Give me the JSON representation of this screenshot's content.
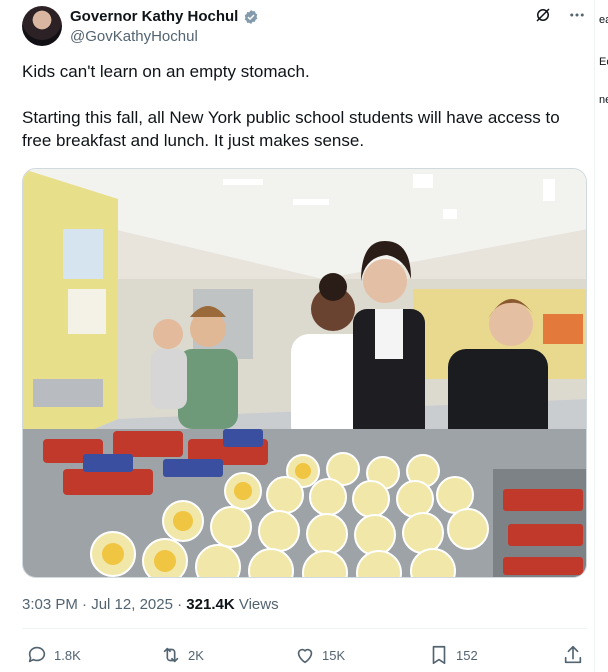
{
  "author": {
    "name": "Governor Kathy Hochul",
    "handle": "@GovKathyHochul",
    "verified_icon": "verified-badge-icon"
  },
  "tweet": {
    "line1": "Kids can't learn on an empty stomach.",
    "line2": "Starting this fall, all New York public school students will have access to free breakfast and lunch. It just makes sense.",
    "time": "3:03 PM",
    "sep1": "·",
    "date": "Jul 12, 2025",
    "sep2": "·",
    "views_count": "321.4K",
    "views_label": "Views"
  },
  "actions": {
    "replies": "1.8K",
    "reposts": "2K",
    "likes": "15K",
    "bookmarks": "152"
  },
  "side": {
    "t1": "ea",
    "t2": "Ec",
    "t3": "ne"
  },
  "colors": {
    "text": "#0f1419",
    "muted": "#536471",
    "verified": "#829aab"
  }
}
